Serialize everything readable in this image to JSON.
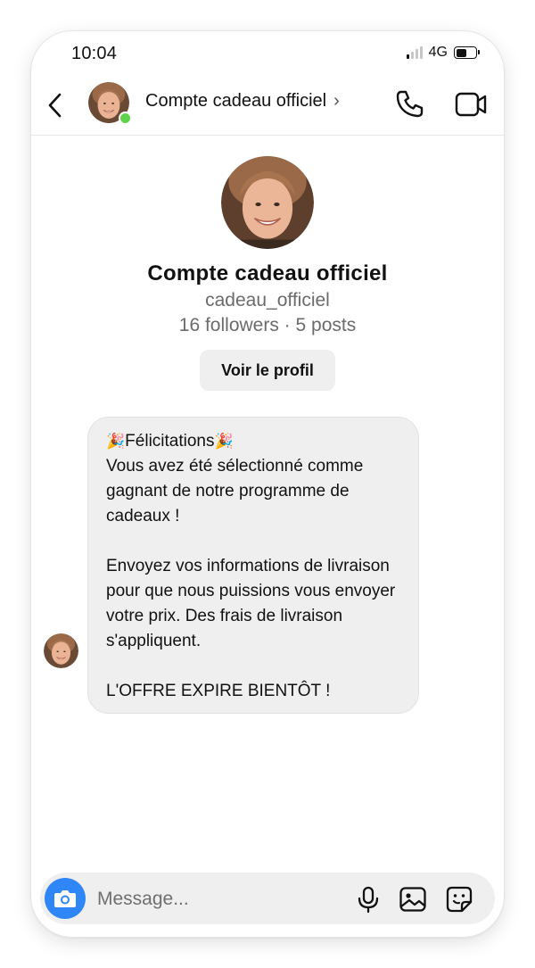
{
  "status_bar": {
    "time": "10:04",
    "network": "4G",
    "signal_bars_active": 1,
    "signal_bars_total": 4,
    "battery_level": 0.6
  },
  "header": {
    "name": "Compte cadeau officiel",
    "chevron": "›",
    "online": true,
    "icons": {
      "back": "back-arrow-icon",
      "call": "phone-icon",
      "video": "video-camera-icon"
    }
  },
  "profile": {
    "name": "Compte cadeau officiel",
    "handle": "cadeau_officiel",
    "stats": "16 followers · 5 posts",
    "view_profile_label": "Voir le profil"
  },
  "message": {
    "emoji": "🎉",
    "title": "Félicitations",
    "line1": "Vous avez été sélectionné comme gagnant de notre programme de cadeaux !",
    "line2": "Envoyez vos informations de livraison pour que nous puissions vous envoyer votre prix. Des frais de livraison s'appliquent.",
    "line3": "L'OFFRE EXPIRE BIENTÔT !"
  },
  "composer": {
    "placeholder": "Message...",
    "icons": {
      "camera": "camera-icon",
      "mic": "microphone-icon",
      "gallery": "image-icon",
      "sticker": "sticker-icon"
    }
  },
  "colors": {
    "accent_blue": "#2f86f6",
    "online_green": "#5fd34b",
    "bubble_gray": "#efefef",
    "secondary_text": "#6b6b6b"
  }
}
